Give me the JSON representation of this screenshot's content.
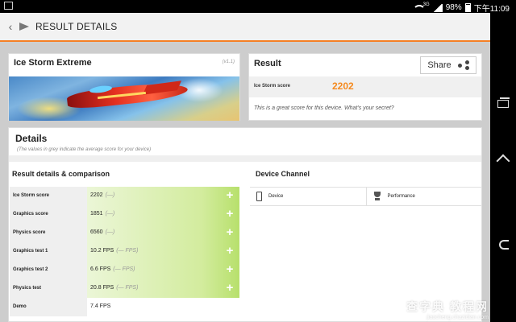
{
  "status_bar": {
    "network": "3G",
    "battery": "98%",
    "time": "下午11:09"
  },
  "action_bar": {
    "title": "RESULT DETAILS"
  },
  "test_card": {
    "name": "Ice Storm Extreme",
    "version": "(v1.1)"
  },
  "result_card": {
    "title": "Result",
    "share_label": "Share",
    "score_label": "Ice Storm score",
    "score_value": "2202",
    "note": "This is a great score for this device. What's your secret?"
  },
  "details": {
    "title": "Details",
    "note": "(The values in grey indicate the average score for your device)",
    "comparison_title": "Result details & comparison",
    "channel_title": "Device Channel",
    "rows": [
      {
        "label": "Ice Storm score",
        "value": "2202",
        "avg": "(—)",
        "bar_fraction": 1.0
      },
      {
        "label": "Graphics score",
        "value": "1851",
        "avg": "(—)",
        "bar_fraction": 1.0
      },
      {
        "label": "Physics score",
        "value": "6560",
        "avg": "(—)",
        "bar_fraction": 1.0
      },
      {
        "label": "Graphics test 1",
        "value": "10.2 FPS",
        "avg": "(— FPS)",
        "bar_fraction": 1.0
      },
      {
        "label": "Graphics test 2",
        "value": "6.6 FPS",
        "avg": "(— FPS)",
        "bar_fraction": 1.0
      },
      {
        "label": "Physics test",
        "value": "20.8 FPS",
        "avg": "(— FPS)",
        "bar_fraction": 1.0
      },
      {
        "label": "Demo",
        "value": "7.4 FPS",
        "avg": "",
        "bar_fraction": 0
      }
    ],
    "channel_tabs": [
      {
        "label": "Device",
        "icon": "phone-icon"
      },
      {
        "label": "Performance",
        "icon": "trophy-icon"
      }
    ]
  },
  "watermark": {
    "main": "查字典 教程网",
    "sub": "jiaocheng.chazidian.com"
  }
}
